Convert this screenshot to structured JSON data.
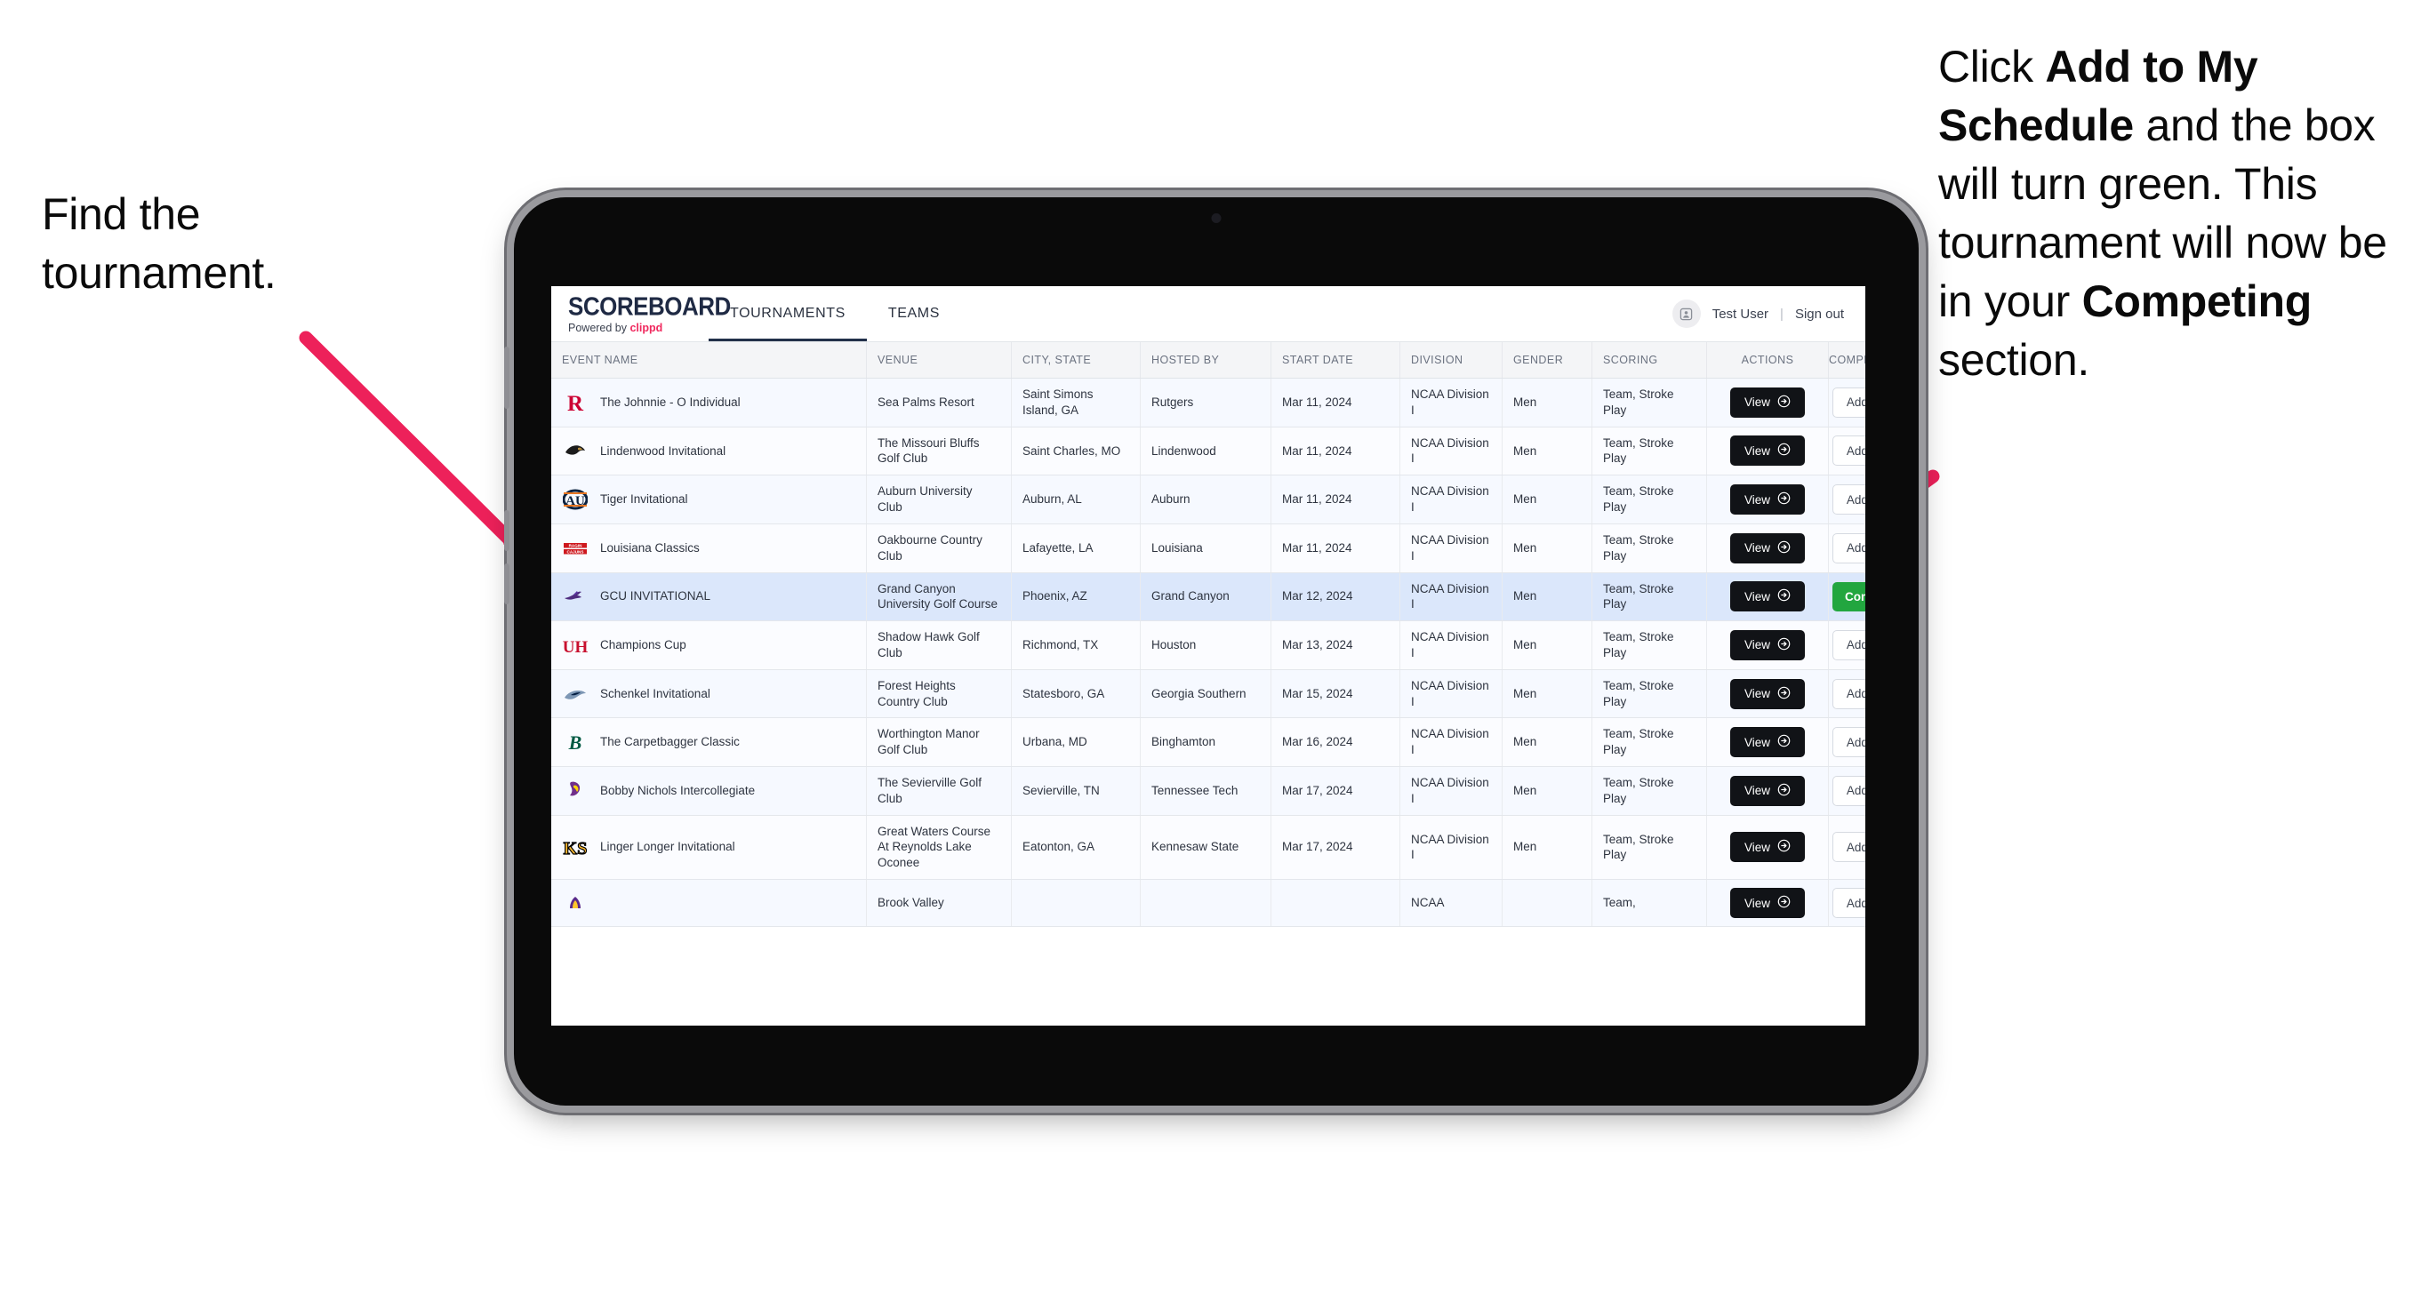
{
  "annotations": {
    "left": "Find the tournament.",
    "right_parts": [
      {
        "text": "Click ",
        "bold": false
      },
      {
        "text": "Add to My Schedule",
        "bold": true
      },
      {
        "text": " and the box will turn green. This tournament will now be in your ",
        "bold": false
      },
      {
        "text": "Competing",
        "bold": true
      },
      {
        "text": " section.",
        "bold": false
      }
    ]
  },
  "app": {
    "brand": {
      "name": "SCOREBOARD",
      "powered_prefix": "Powered by ",
      "powered_brand": "clippd"
    },
    "tabs": [
      {
        "label": "TOURNAMENTS",
        "active": true
      },
      {
        "label": "TEAMS",
        "active": false
      }
    ],
    "user": {
      "name": "Test User",
      "separator": "|",
      "sign_out": "Sign out",
      "avatar_icon": "user-avatar-icon"
    },
    "table": {
      "columns": [
        "EVENT NAME",
        "VENUE",
        "CITY, STATE",
        "HOSTED BY",
        "START DATE",
        "DIVISION",
        "GENDER",
        "SCORING",
        "ACTIONS",
        "COMPETING"
      ],
      "view_label": "View",
      "add_label": "Add to My Schedule",
      "competing_label": "Competing",
      "rows": [
        {
          "logo": "rutgers-logo",
          "event": "The Johnnie - O Individual",
          "venue": "Sea Palms Resort",
          "city": "Saint Simons Island, GA",
          "host": "Rutgers",
          "date": "Mar 11, 2024",
          "division": "NCAA Division I",
          "gender": "Men",
          "scoring": "Team, Stroke Play",
          "competing": false,
          "selected": false
        },
        {
          "logo": "lindenwood-logo",
          "event": "Lindenwood Invitational",
          "venue": "The Missouri Bluffs Golf Club",
          "city": "Saint Charles, MO",
          "host": "Lindenwood",
          "date": "Mar 11, 2024",
          "division": "NCAA Division I",
          "gender": "Men",
          "scoring": "Team, Stroke Play",
          "competing": false,
          "selected": false
        },
        {
          "logo": "auburn-logo",
          "event": "Tiger Invitational",
          "venue": "Auburn University Club",
          "city": "Auburn, AL",
          "host": "Auburn",
          "date": "Mar 11, 2024",
          "division": "NCAA Division I",
          "gender": "Men",
          "scoring": "Team, Stroke Play",
          "competing": false,
          "selected": false
        },
        {
          "logo": "louisiana-logo",
          "event": "Louisiana Classics",
          "venue": "Oakbourne Country Club",
          "city": "Lafayette, LA",
          "host": "Louisiana",
          "date": "Mar 11, 2024",
          "division": "NCAA Division I",
          "gender": "Men",
          "scoring": "Team, Stroke Play",
          "competing": false,
          "selected": false
        },
        {
          "logo": "gcu-logo",
          "event": "GCU INVITATIONAL",
          "venue": "Grand Canyon University Golf Course",
          "city": "Phoenix, AZ",
          "host": "Grand Canyon",
          "date": "Mar 12, 2024",
          "division": "NCAA Division I",
          "gender": "Men",
          "scoring": "Team, Stroke Play",
          "competing": true,
          "selected": true
        },
        {
          "logo": "houston-logo",
          "event": "Champions Cup",
          "venue": "Shadow Hawk Golf Club",
          "city": "Richmond, TX",
          "host": "Houston",
          "date": "Mar 13, 2024",
          "division": "NCAA Division I",
          "gender": "Men",
          "scoring": "Team, Stroke Play",
          "competing": false,
          "selected": false
        },
        {
          "logo": "georgia-southern-logo",
          "event": "Schenkel Invitational",
          "venue": "Forest Heights Country Club",
          "city": "Statesboro, GA",
          "host": "Georgia Southern",
          "date": "Mar 15, 2024",
          "division": "NCAA Division I",
          "gender": "Men",
          "scoring": "Team, Stroke Play",
          "competing": false,
          "selected": false
        },
        {
          "logo": "binghamton-logo",
          "event": "The Carpetbagger Classic",
          "venue": "Worthington Manor Golf Club",
          "city": "Urbana, MD",
          "host": "Binghamton",
          "date": "Mar 16, 2024",
          "division": "NCAA Division I",
          "gender": "Men",
          "scoring": "Team, Stroke Play",
          "competing": false,
          "selected": false
        },
        {
          "logo": "tennessee-tech-logo",
          "event": "Bobby Nichols Intercollegiate",
          "venue": "The Sevierville Golf Club",
          "city": "Sevierville, TN",
          "host": "Tennessee Tech",
          "date": "Mar 17, 2024",
          "division": "NCAA Division I",
          "gender": "Men",
          "scoring": "Team, Stroke Play",
          "competing": false,
          "selected": false
        },
        {
          "logo": "kennesaw-logo",
          "event": "Linger Longer Invitational",
          "venue": "Great Waters Course At Reynolds Lake Oconee",
          "city": "Eatonton, GA",
          "host": "Kennesaw State",
          "date": "Mar 17, 2024",
          "division": "NCAA Division I",
          "gender": "Men",
          "scoring": "Team, Stroke Play",
          "competing": false,
          "selected": false
        },
        {
          "logo": "ecu-logo",
          "event": "",
          "venue": "Brook Valley",
          "city": "",
          "host": "",
          "date": "",
          "division": "NCAA",
          "gender": "",
          "scoring": "Team,",
          "competing": false,
          "selected": false
        }
      ]
    }
  },
  "colors": {
    "arrow": "#ED215A",
    "competing_green": "#22A63F",
    "selected_row": "#DBE7FB",
    "brand_navy": "#1F2A44",
    "clippd_pink": "#F0295E"
  }
}
